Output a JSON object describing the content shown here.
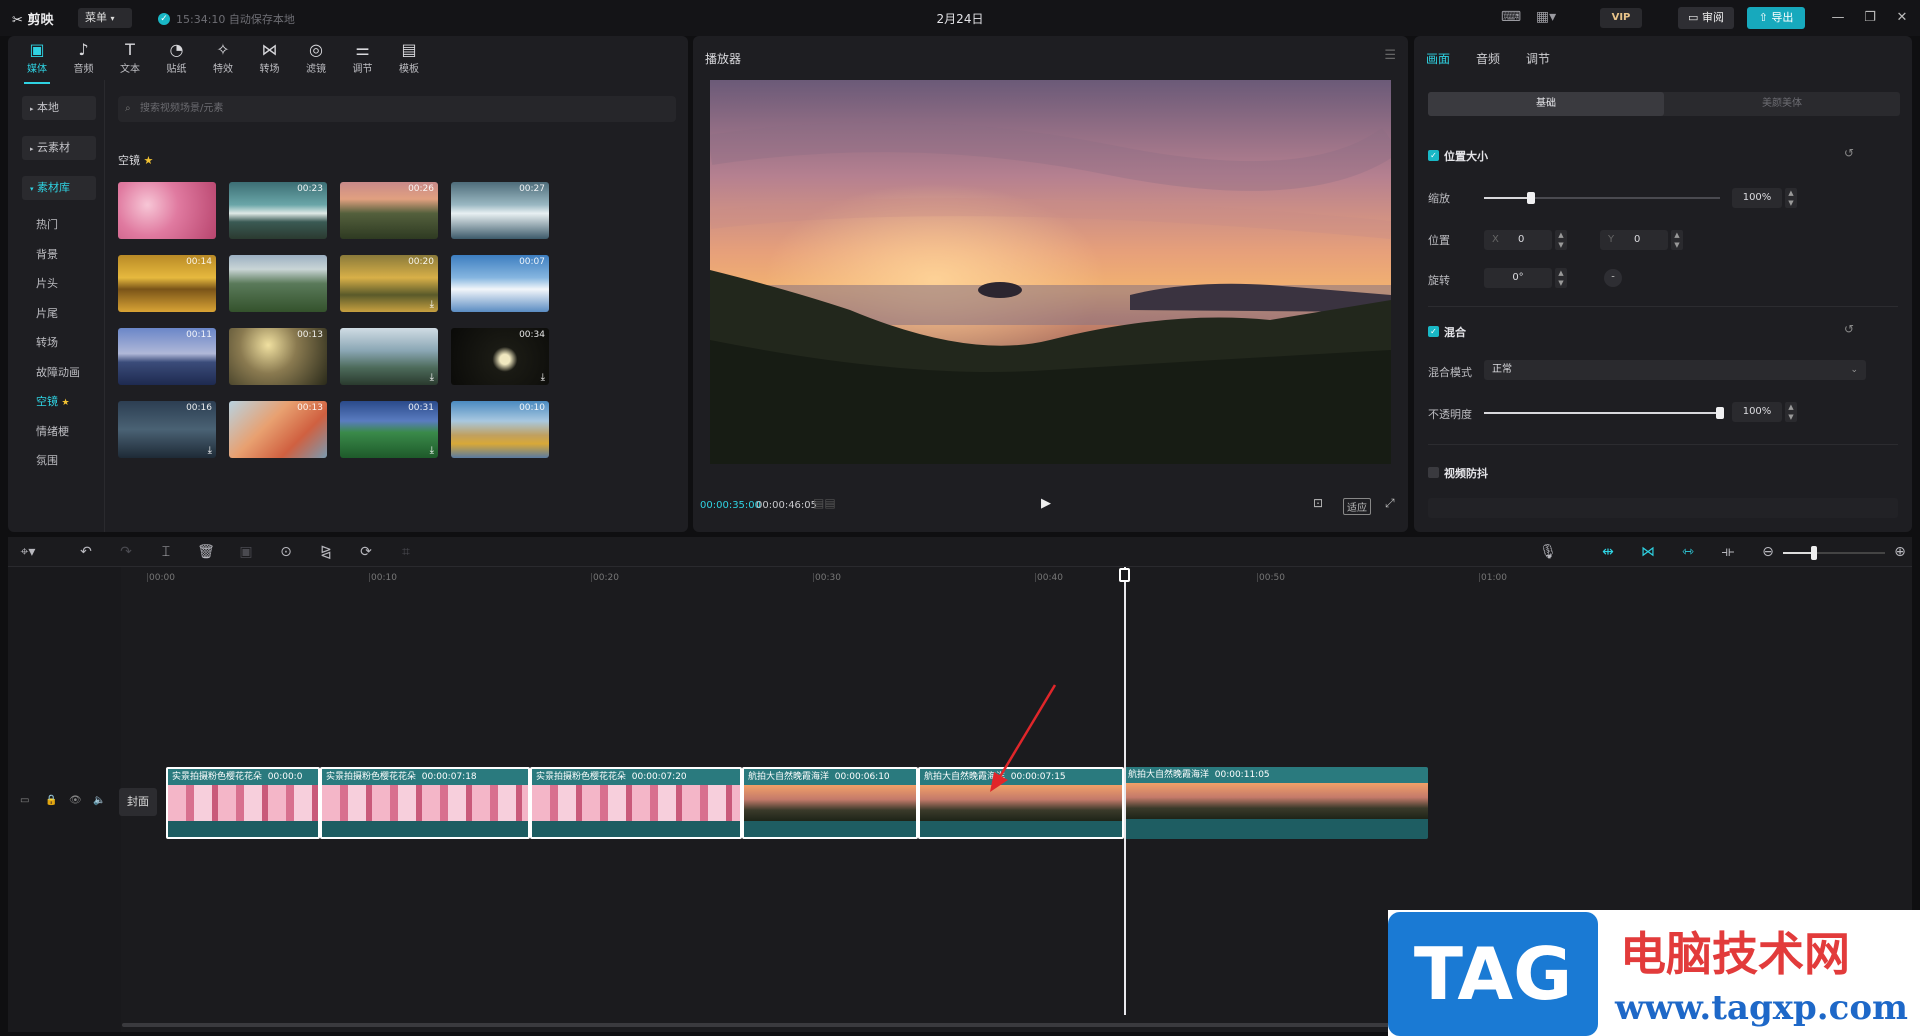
{
  "titlebar": {
    "logo": "剪映",
    "menu_label": "菜单",
    "save_status": "15:34:10 自动保存本地",
    "date_title": "2月24日",
    "vip_label": "VIP",
    "review_label": "审阅",
    "export_label": "导出"
  },
  "media_tabs": [
    {
      "label": "媒体",
      "icon": "media-icon"
    },
    {
      "label": "音频",
      "icon": "audio-icon"
    },
    {
      "label": "文本",
      "icon": "text-icon"
    },
    {
      "label": "贴纸",
      "icon": "sticker-icon"
    },
    {
      "label": "特效",
      "icon": "effects-icon"
    },
    {
      "label": "转场",
      "icon": "transition-icon"
    },
    {
      "label": "滤镜",
      "icon": "filter-icon"
    },
    {
      "label": "调节",
      "icon": "adjust-icon"
    },
    {
      "label": "模板",
      "icon": "template-icon"
    }
  ],
  "sidebar": {
    "local": "本地",
    "cloud": "云素材",
    "library": "素材库",
    "sub_items": [
      "热门",
      "背景",
      "片头",
      "片尾",
      "转场",
      "故障动画",
      "空镜",
      "情绪梗",
      "氛围"
    ]
  },
  "search_placeholder": "搜索视频场景/元素",
  "section_title": "空镜",
  "thumbnails": [
    {
      "duration": "",
      "download": false
    },
    {
      "duration": "00:23",
      "download": false
    },
    {
      "duration": "00:26",
      "download": false
    },
    {
      "duration": "00:27",
      "download": false
    },
    {
      "duration": "00:14",
      "download": false
    },
    {
      "duration": "",
      "download": false
    },
    {
      "duration": "00:20",
      "download": true
    },
    {
      "duration": "00:07",
      "download": false
    },
    {
      "duration": "00:11",
      "download": false
    },
    {
      "duration": "00:13",
      "download": false
    },
    {
      "duration": "",
      "download": true
    },
    {
      "duration": "00:34",
      "download": true
    },
    {
      "duration": "00:16",
      "download": true
    },
    {
      "duration": "00:13",
      "download": false
    },
    {
      "duration": "00:31",
      "download": true
    },
    {
      "duration": "00:10",
      "download": false
    }
  ],
  "player": {
    "title": "播放器",
    "current_time": "00:00:35:00",
    "total_time": "00:00:46:05",
    "ratio_label": "适应"
  },
  "props": {
    "tabs": [
      "画面",
      "音频",
      "调节"
    ],
    "seg_basic": "基础",
    "seg_beauty": "美颜美体",
    "pos_size": "位置大小",
    "scale_label": "缩放",
    "scale_value": "100%",
    "scale_level": 0.2,
    "position_label": "位置",
    "x_label": "X",
    "x_value": "0",
    "y_label": "Y",
    "y_value": "0",
    "rotate_label": "旋转",
    "rotate_value": "0°",
    "blend": "混合",
    "blend_mode_label": "混合模式",
    "blend_mode_value": "正常",
    "opacity_label": "不透明度",
    "opacity_value": "100%",
    "opacity_level": 1.0,
    "stabilize": "视频防抖"
  },
  "timeline": {
    "ruler": [
      "00:00",
      "00:10",
      "00:20",
      "00:30",
      "00:40",
      "00:50",
      "01:00"
    ],
    "cover_label": "封面",
    "clips": [
      {
        "title": "实景拍摄粉色樱花花朵",
        "duration": "00:00:0",
        "kind": "blossom"
      },
      {
        "title": "实景拍摄粉色樱花花朵",
        "duration": "00:00:07:18",
        "kind": "blossom"
      },
      {
        "title": "实景拍摄粉色樱花花朵",
        "duration": "00:00:07:20",
        "kind": "blossom"
      },
      {
        "title": "航拍大自然晚霞海洋",
        "duration": "00:00:06:10",
        "kind": "sunset"
      },
      {
        "title": "航拍大自然晚霞海洋",
        "duration": "00:00:07:15",
        "kind": "sunset"
      },
      {
        "title": "航拍大自然晚霞海洋",
        "duration": "00:00:11:05",
        "kind": "sunset"
      }
    ]
  },
  "watermark": {
    "tag": "TAG",
    "cn": "电脑技术网",
    "url": "www.tagxp.com"
  },
  "colors": {
    "accent": "#2fd2e2",
    "clip_header": "#2a7a7e",
    "export": "#17a9bd"
  }
}
